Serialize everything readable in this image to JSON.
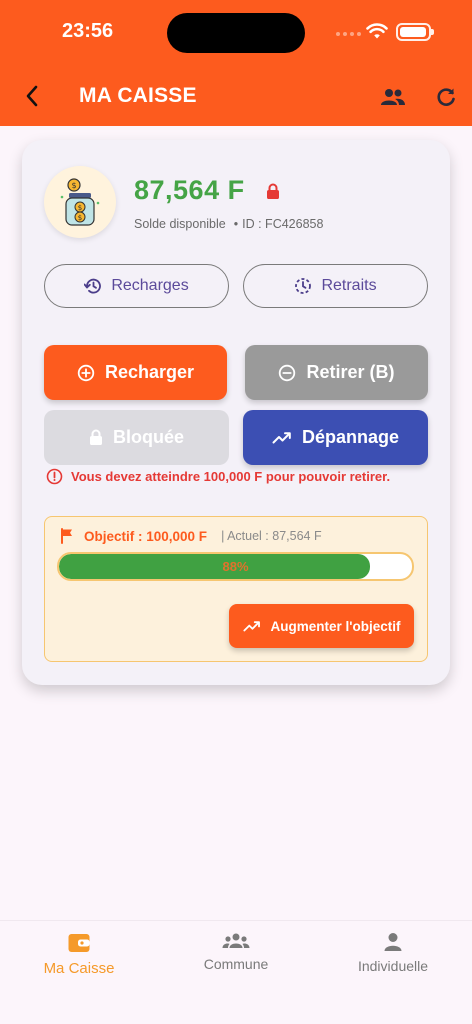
{
  "status_bar": {
    "time": "23:56"
  },
  "header": {
    "title": "MA CAISSE",
    "back_icon": "chevron-left-icon",
    "group_icon": "group-icon",
    "refresh_icon": "refresh-icon"
  },
  "wallet": {
    "balance": "87,564 F",
    "balance_label": "Solde disponible",
    "id_text": "ID : FC426858",
    "balance_color": "#45a446",
    "lock_icon": "lock-icon"
  },
  "history_buttons": {
    "recharges_label": "Recharges",
    "retraits_label": "Retraits"
  },
  "actions": {
    "recharger_label": "Recharger",
    "retirer_label": "Retirer (B)",
    "bloquee_label": "Bloquée",
    "depannage_label": "Dépannage"
  },
  "warning": {
    "text": "Vous devez atteindre 100,000 F pour pouvoir retirer."
  },
  "goal": {
    "label": "Objectif : 100,000 F",
    "actual": "| Actuel : 87,564 F",
    "progress_text": "88%",
    "progress": 0.88,
    "augmenter_label": "Augmenter l'objectif"
  },
  "bottom_nav": {
    "items": [
      {
        "label": "Ma Caisse",
        "icon": "wallet-icon",
        "active": true
      },
      {
        "label": "Commune",
        "icon": "group-icon",
        "active": false
      },
      {
        "label": "Individuelle",
        "icon": "person-icon",
        "active": false
      }
    ]
  },
  "colors": {
    "primary": "#fd5b1e",
    "success": "#40a142",
    "indigo": "#3c4fb3",
    "danger": "#e53935",
    "accent_nav": "#f59a2a"
  }
}
